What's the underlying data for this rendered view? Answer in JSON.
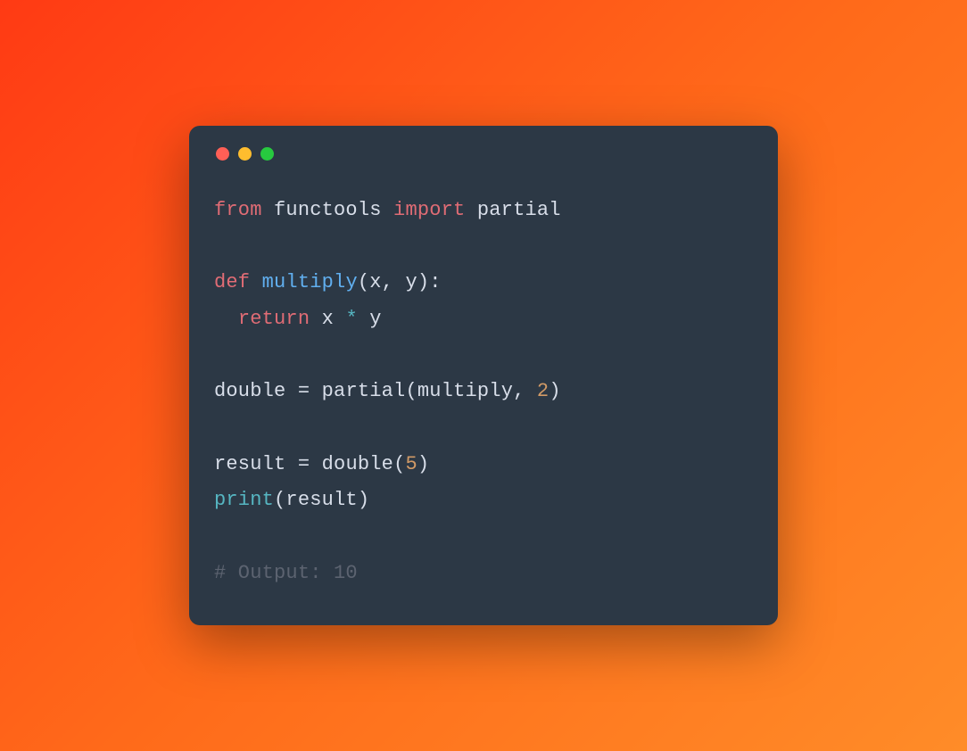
{
  "colors": {
    "window_bg": "#2c3845",
    "gradient_start": "#ff3a14",
    "gradient_end": "#ff8c28",
    "dot_red": "#ff5f56",
    "dot_yellow": "#ffbd2e",
    "dot_green": "#27c93f",
    "keyword": "#e06c75",
    "function": "#61afef",
    "operator": "#56b6c2",
    "number": "#d19a66",
    "comment": "#5c6370",
    "default": "#d8dee9"
  },
  "code": {
    "line1": {
      "kw_from": "from",
      "module": "functools",
      "kw_import": "import",
      "name": "partial"
    },
    "line3": {
      "kw_def": "def",
      "fn_name": "multiply",
      "params_open": "(",
      "param_x": "x",
      "comma1": ", ",
      "param_y": "y",
      "params_close": "):"
    },
    "line4": {
      "indent": "  ",
      "kw_return": "return",
      "expr_x": "x",
      "op": "*",
      "expr_y": "y"
    },
    "line6": {
      "lhs": "double",
      "eq": " = ",
      "fn": "partial",
      "open": "(",
      "arg1": "multiply",
      "comma": ", ",
      "arg2": "2",
      "close": ")"
    },
    "line8": {
      "lhs": "result",
      "eq": " = ",
      "fn": "double",
      "open": "(",
      "arg": "5",
      "close": ")"
    },
    "line9": {
      "fn": "print",
      "open": "(",
      "arg": "result",
      "close": ")"
    },
    "line11": {
      "comment": "# Output: 10"
    }
  }
}
